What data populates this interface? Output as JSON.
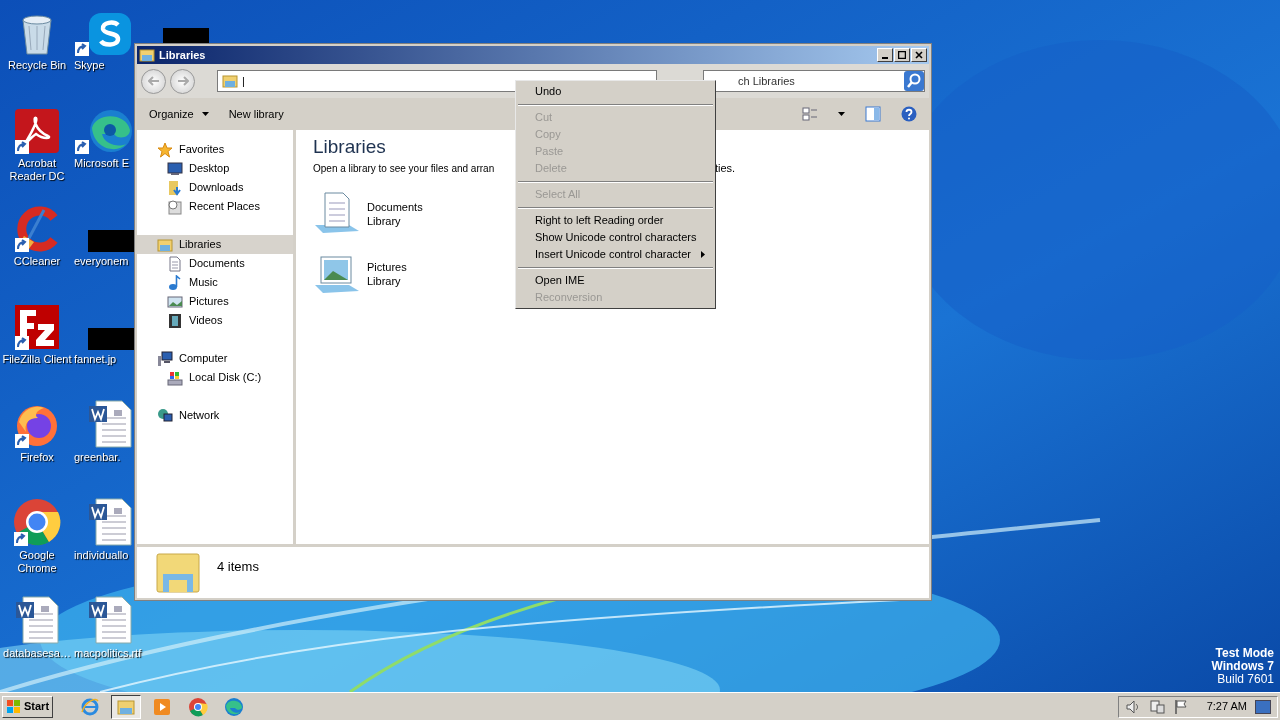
{
  "desktop_icons_left": [
    {
      "label": "Recycle Bin",
      "kind": "recycle",
      "shortcut": false
    },
    {
      "label": "Acrobat Reader DC",
      "kind": "acrobat",
      "shortcut": true
    },
    {
      "label": "CCleaner",
      "kind": "ccleaner",
      "shortcut": true
    },
    {
      "label": "FileZilla Client",
      "kind": "filezilla",
      "shortcut": true
    },
    {
      "label": "Firefox",
      "kind": "firefox",
      "shortcut": true
    },
    {
      "label": "Google Chrome",
      "kind": "chrome",
      "shortcut": true
    },
    {
      "label": "databasesa…",
      "kind": "word",
      "shortcut": false
    }
  ],
  "desktop_icons_right": [
    {
      "label": "Skype",
      "kind": "skype",
      "shortcut": true
    },
    {
      "label": "Microsoft E",
      "kind": "edge",
      "shortcut": true
    },
    {
      "label": "everyonem",
      "kind": "redacted",
      "shortcut": false
    },
    {
      "label": "fannet.jp",
      "kind": "redacted",
      "shortcut": false
    },
    {
      "label": "greenbar.",
      "kind": "word",
      "shortcut": false
    },
    {
      "label": "individuallo",
      "kind": "word",
      "shortcut": false
    },
    {
      "label": "macpolitics.rtf",
      "kind": "word",
      "shortcut": false
    }
  ],
  "window": {
    "title": "Libraries",
    "address": "|",
    "search_placeholder": "ch Libraries",
    "toolbar": [
      {
        "label": "Organize",
        "dropdown": true
      },
      {
        "label": "New library",
        "dropdown": false
      }
    ],
    "nav": [
      {
        "label": "Favorites",
        "kind": "star",
        "selected": false,
        "children": [
          {
            "label": "Desktop",
            "kind": "desktop",
            "selected": false
          },
          {
            "label": "Downloads",
            "kind": "downloads",
            "selected": false
          },
          {
            "label": "Recent Places",
            "kind": "recent",
            "selected": false
          }
        ]
      },
      {
        "label": "Libraries",
        "kind": "library",
        "selected": true,
        "children": [
          {
            "label": "Documents",
            "kind": "document",
            "selected": false
          },
          {
            "label": "Music",
            "kind": "music",
            "selected": false
          },
          {
            "label": "Pictures",
            "kind": "pictures",
            "selected": false
          },
          {
            "label": "Videos",
            "kind": "videos",
            "selected": false
          }
        ]
      },
      {
        "label": "Computer",
        "kind": "computer",
        "selected": false,
        "children": [
          {
            "label": "Local Disk (C:)",
            "kind": "disk",
            "selected": false
          }
        ]
      },
      {
        "label": "Network",
        "kind": "network",
        "selected": false
      }
    ],
    "heading": "Libraries",
    "description_left": "Open a library to see your files and arran",
    "description_right": "ties.",
    "libraries": [
      {
        "name": "Documents",
        "sub": "Library",
        "kind": "document"
      },
      {
        "name": "Pictures",
        "sub": "Library",
        "kind": "pictures"
      }
    ],
    "status": "4 items"
  },
  "context_menu": [
    {
      "kind": "item",
      "label": "Undo",
      "disabled": false,
      "submenu": false
    },
    {
      "kind": "separator"
    },
    {
      "kind": "item",
      "label": "Cut",
      "disabled": true,
      "submenu": false
    },
    {
      "kind": "item",
      "label": "Copy",
      "disabled": true,
      "submenu": false
    },
    {
      "kind": "item",
      "label": "Paste",
      "disabled": true,
      "submenu": false
    },
    {
      "kind": "item",
      "label": "Delete",
      "disabled": true,
      "submenu": false
    },
    {
      "kind": "separator"
    },
    {
      "kind": "item",
      "label": "Select All",
      "disabled": true,
      "submenu": false
    },
    {
      "kind": "separator"
    },
    {
      "kind": "item",
      "label": "Right to left Reading order",
      "disabled": false,
      "submenu": false
    },
    {
      "kind": "item",
      "label": "Show Unicode control characters",
      "disabled": false,
      "submenu": false
    },
    {
      "kind": "item",
      "label": "Insert Unicode control character",
      "disabled": false,
      "submenu": true
    },
    {
      "kind": "separator"
    },
    {
      "kind": "item",
      "label": "Open IME",
      "disabled": false,
      "submenu": false
    },
    {
      "kind": "item",
      "label": "Reconversion",
      "disabled": true,
      "submenu": false
    }
  ],
  "os_notice": [
    "Test Mode",
    "Windows 7",
    "Build 7601"
  ],
  "taskbar": {
    "start": "Start",
    "apps": [
      {
        "kind": "ie",
        "active": false
      },
      {
        "kind": "explorer",
        "active": true
      },
      {
        "kind": "media",
        "active": false
      },
      {
        "kind": "chrome",
        "active": false
      },
      {
        "kind": "edge",
        "active": false
      }
    ],
    "clock": "7:27 AM"
  }
}
